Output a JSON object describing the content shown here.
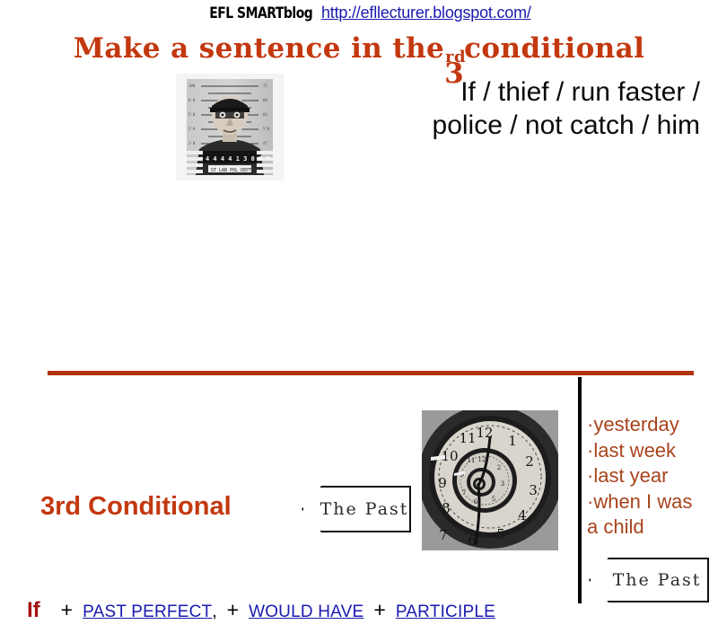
{
  "header": {
    "blog_name": "EFL SMARTblog",
    "blog_url": "http://efllecturer.blogspot.com/"
  },
  "title": {
    "before": "Make a sentence in the",
    "ordinal_number": "3",
    "ordinal_suffix": "rd",
    "after": "conditional"
  },
  "prompt": {
    "line1": "If / thief / run faster /",
    "line2": "police / not catch / him"
  },
  "images": {
    "mugshot_alt": "mugshot-photo",
    "clock_alt": "spiral-clock-photo"
  },
  "body": {
    "conditional_label": "3rd Conditional",
    "past_banner_1": "The Past",
    "past_banner_2": "The Past"
  },
  "time_expressions": {
    "bullet": "·",
    "items": [
      "yesterday",
      "last week",
      "last year",
      "when I was"
    ],
    "continuation": "a child"
  },
  "formula": {
    "if_word": "If",
    "plus_1": "+",
    "term_1": "PAST PERFECT ",
    "comma": ",",
    "plus_2": "+",
    "term_2": "WOULD HAVE",
    "plus_3": "+",
    "term_3": "PARTICIPLE"
  },
  "colors": {
    "brand_red": "#c3380f",
    "divider_red": "#b33211",
    "list_brown": "#a8441d",
    "link_blue": "#1a1ab0",
    "if_red": "#a41414"
  }
}
